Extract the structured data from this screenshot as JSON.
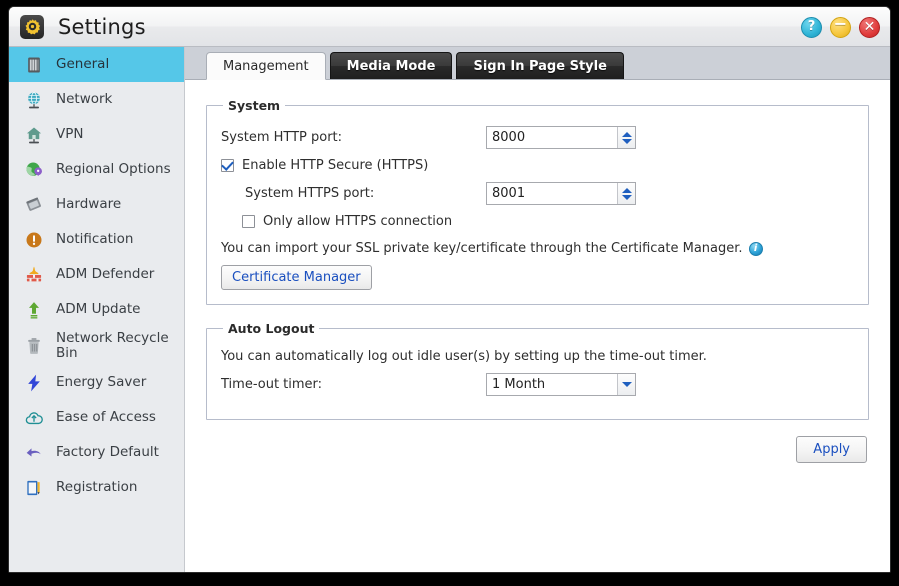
{
  "window": {
    "title": "Settings",
    "app_icon": "gear-icon",
    "controls": [
      {
        "name": "help-button",
        "glyph": "?",
        "color": "#2fb4d6"
      },
      {
        "name": "minimize-button",
        "glyph": "−",
        "color": "#f5c63c"
      },
      {
        "name": "close-button",
        "glyph": "✕",
        "color": "#e03c3c"
      }
    ]
  },
  "sidebar": {
    "active_index": 0,
    "active_color": "#55c7e8",
    "items": [
      {
        "label": "General",
        "icon": "nas-server-icon"
      },
      {
        "label": "Network",
        "icon": "globe-icon"
      },
      {
        "label": "VPN",
        "icon": "house-network-icon"
      },
      {
        "label": "Regional Options",
        "icon": "globe-pin-icon"
      },
      {
        "label": "Hardware",
        "icon": "chip-icon"
      },
      {
        "label": "Notification",
        "icon": "exclamation-circle-icon"
      },
      {
        "label": "ADM Defender",
        "icon": "firewall-icon"
      },
      {
        "label": "ADM Update",
        "icon": "up-arrow-icon"
      },
      {
        "label": "Network Recycle Bin",
        "icon": "trash-icon"
      },
      {
        "label": "Energy Saver",
        "icon": "lightning-bolt-icon"
      },
      {
        "label": "Ease of Access",
        "icon": "cloud-upload-icon"
      },
      {
        "label": "Factory Default",
        "icon": "undo-arrow-icon"
      },
      {
        "label": "Registration",
        "icon": "clipboard-pencil-icon"
      }
    ]
  },
  "tabs": [
    {
      "label": "Management",
      "active": true
    },
    {
      "label": "Media Mode",
      "active": false
    },
    {
      "label": "Sign In Page Style",
      "active": false
    }
  ],
  "system_section": {
    "legend": "System",
    "http_port_label": "System HTTP port:",
    "http_port_value": "8000",
    "http_port_placeholder": "",
    "enable_https_label": "Enable HTTP Secure (HTTPS)",
    "enable_https_checked": true,
    "https_port_label": "System HTTPS port:",
    "https_port_value": "8001",
    "https_port_placeholder": "",
    "only_https_label": "Only allow HTTPS connection",
    "only_https_checked": false,
    "ssl_note": "You can import your SSL private key/certificate through the Certificate Manager.",
    "info_glyph": "i",
    "certificate_manager_button": "Certificate Manager"
  },
  "auto_logout_section": {
    "legend": "Auto Logout",
    "description": "You can automatically log out idle user(s) by setting up the time-out timer.",
    "timer_label": "Time-out timer:",
    "timer_value": "1 Month"
  },
  "footer": {
    "apply_label": "Apply"
  }
}
